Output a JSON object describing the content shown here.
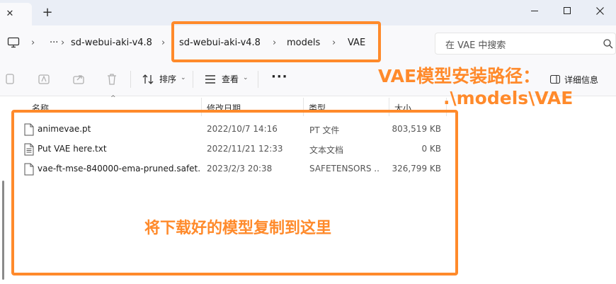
{
  "window": {
    "new_tab_symbol": "+",
    "tab_close_symbol": "✕"
  },
  "breadcrumb": {
    "overflow": "···",
    "items": [
      "sd-webui-aki-v4.8",
      "sd-webui-aki-v4.8",
      "models",
      "VAE"
    ],
    "separator": "›"
  },
  "search": {
    "placeholder": "在 VAE 中搜索"
  },
  "toolbar": {
    "sort_label": "排序",
    "view_label": "查看",
    "more_label": "···",
    "details_label": "详细信息"
  },
  "columns": {
    "name": "名称",
    "date": "修改日期",
    "type": "类型",
    "size": "大小"
  },
  "files": [
    {
      "name": "animevae.pt",
      "date": "2022/10/7 14:16",
      "type": "PT 文件",
      "size": "803,519 KB"
    },
    {
      "name": "Put VAE here.txt",
      "date": "2022/11/21 12:33",
      "type": "文本文档",
      "size": "0 KB"
    },
    {
      "name": "vae-ft-mse-840000-ema-pruned.safet...",
      "date": "2023/2/3 20:38",
      "type": "SAFETENSORS ...",
      "size": "326,799 KB"
    }
  ],
  "annotations": {
    "path_note_line1": "VAE模型安装路径：",
    "path_note_line2": ".\\models\\VAE",
    "drop_note": "将下载好的模型复制到这里"
  },
  "colors": {
    "annotation": "#ff8a2b",
    "titlebar": "#eaeef6",
    "toolbar": "#f9f9fb"
  }
}
